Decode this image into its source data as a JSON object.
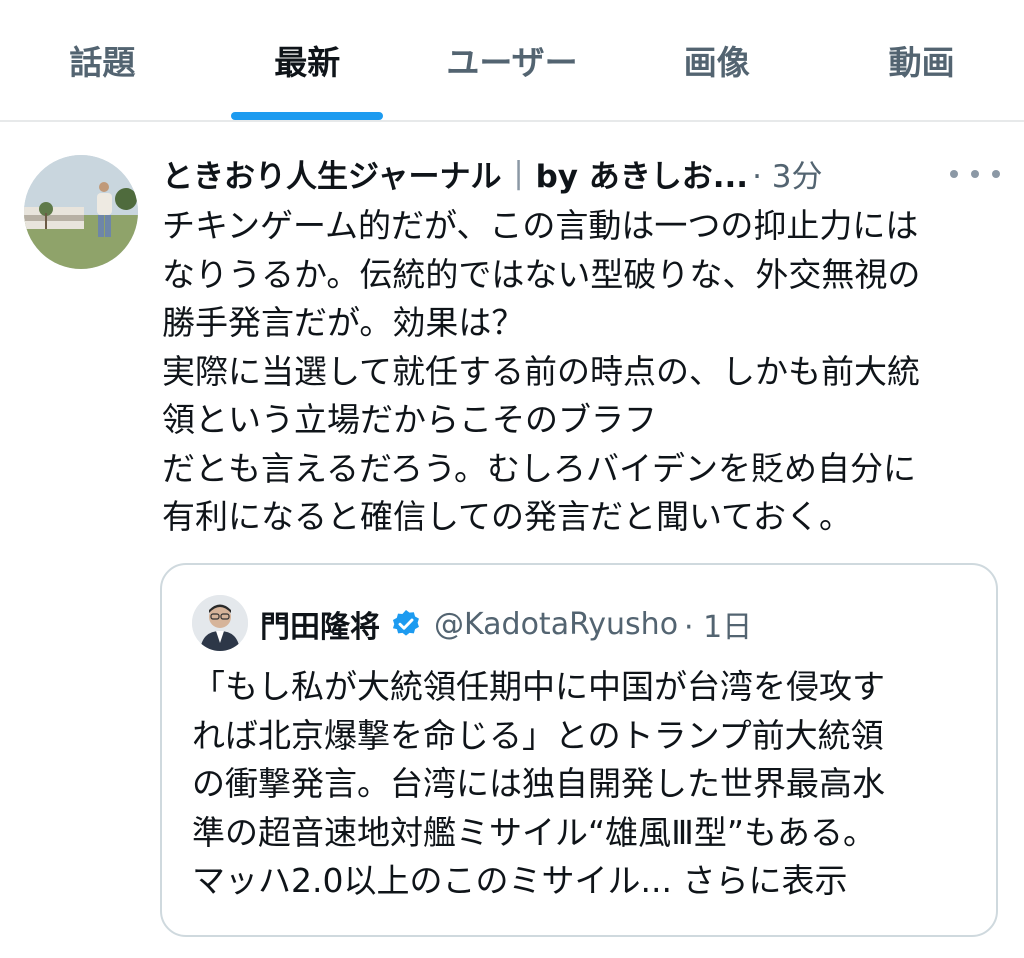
{
  "tabs": [
    {
      "label": "話題",
      "active": false
    },
    {
      "label": "最新",
      "active": true
    },
    {
      "label": "ユーザー",
      "active": false
    },
    {
      "label": "画像",
      "active": false
    },
    {
      "label": "動画",
      "active": false
    }
  ],
  "tweet": {
    "author_name": "ときおり人生ジャーナル",
    "separator": "|",
    "author_suffix": "by あきしお...",
    "time": "· 3分",
    "more_icon": "more-icon",
    "lines": [
      "チキンゲーム的だが、この言動は一つの抑止力には",
      "なりうるか。伝統的ではない型破りな、外交無視の",
      "勝手発言だが。効果は？",
      "実際に当選して就任する前の時点の、しかも前大統",
      "領という立場だからこそのブラフ",
      "だとも言えるだろう。むしろバイデンを貶め自分に",
      "有利になると確信しての発言だと聞いておく。"
    ]
  },
  "quote": {
    "author_name": "門田隆将",
    "verified_icon": "verified-badge-icon",
    "handle": "@KadotaRyusho",
    "time": "· 1日",
    "lines": [
      "「もし私が大統領任期中に中国が台湾を侵攻す",
      "れば北京爆撃を命じる」とのトランプ前大統領",
      "の衝撃発言。台湾には独自開発した世界最高水",
      "準の超音速地対艦ミサイル“雄風Ⅲ型”もある。",
      "マッハ2.0以上のこのミサイル... さらに表示"
    ]
  },
  "colors": {
    "accent": "#1d9bf0",
    "text": "#0f1419",
    "secondary": "#536471",
    "border": "#cfd9de"
  }
}
